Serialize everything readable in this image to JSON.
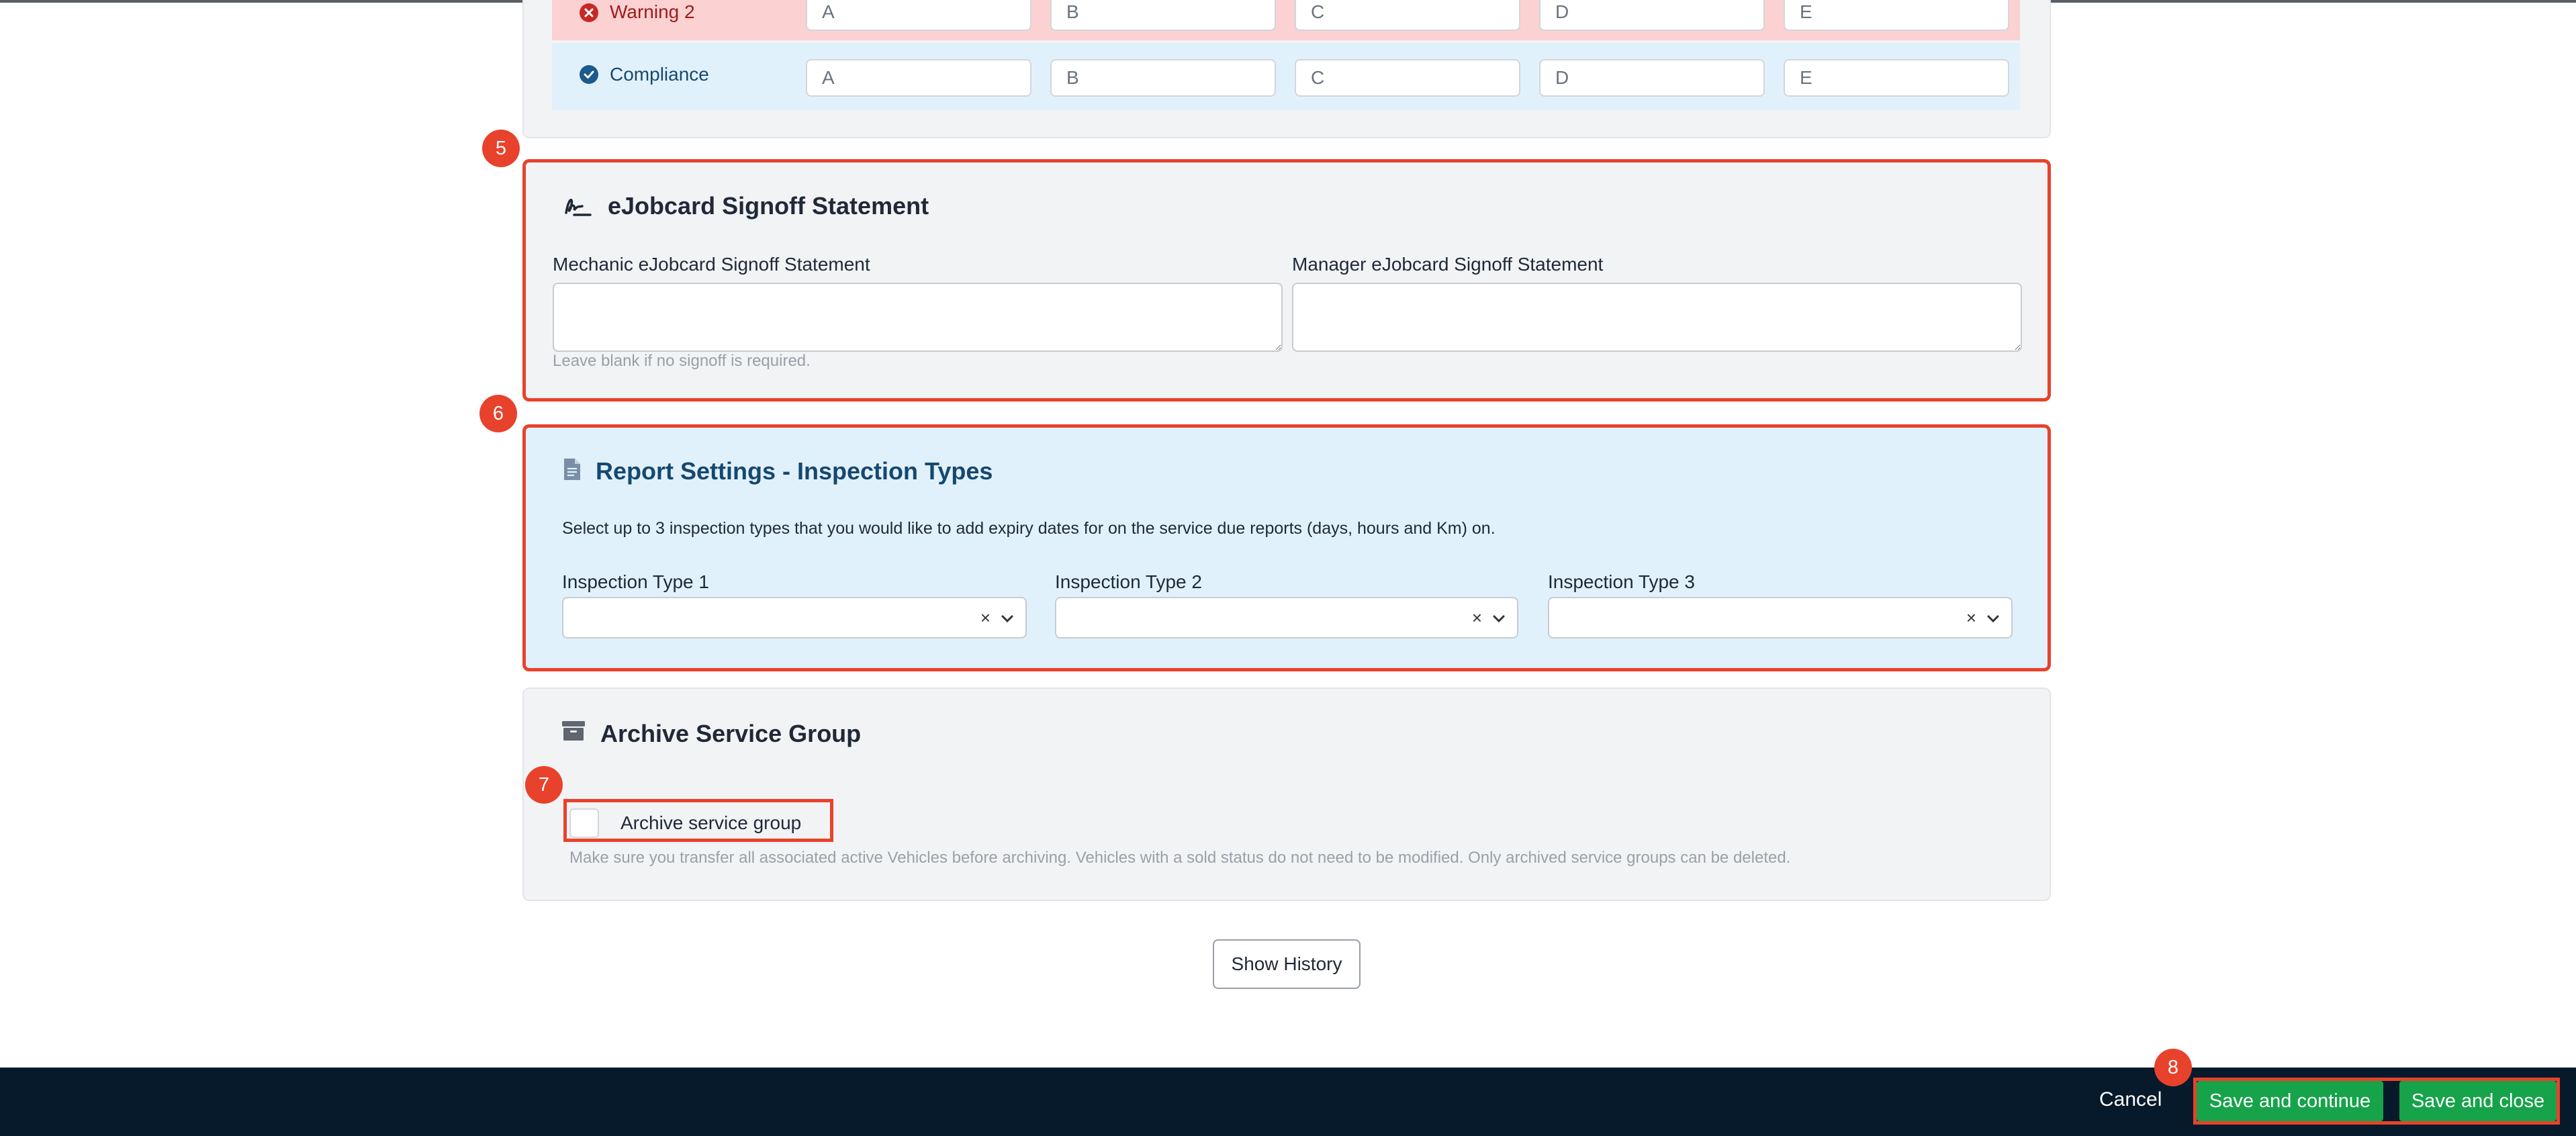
{
  "options_table": {
    "rows": [
      {
        "label": "Warning 2",
        "status": "error",
        "cells": [
          "A",
          "B",
          "C",
          "D",
          "E"
        ]
      },
      {
        "label": "Compliance",
        "status": "ok",
        "cells": [
          "A",
          "B",
          "C",
          "D",
          "E"
        ]
      }
    ]
  },
  "signoff": {
    "badge": "5",
    "title": "eJobcard Signoff Statement",
    "mechanic_label": "Mechanic eJobcard Signoff Statement",
    "manager_label": "Manager eJobcard Signoff Statement",
    "help": "Leave blank if no signoff is required."
  },
  "report_settings": {
    "badge": "6",
    "title": "Report Settings - Inspection Types",
    "description": "Select up to 3 inspection types that you would like to add expiry dates for on the service due reports (days, hours and Km) on.",
    "fields": [
      {
        "label": "Inspection Type 1",
        "value": ""
      },
      {
        "label": "Inspection Type 2",
        "value": ""
      },
      {
        "label": "Inspection Type 3",
        "value": ""
      }
    ],
    "clear_glyph": "×"
  },
  "archive": {
    "badge": "7",
    "title": "Archive Service Group",
    "checkbox_label": "Archive service group",
    "checked": false,
    "help": "Make sure you transfer all associated active Vehicles before archiving. Vehicles with a sold status do not need to be modified. Only archived service groups can be deleted."
  },
  "history_button": "Show History",
  "footer": {
    "badge": "8",
    "cancel": "Cancel",
    "save_continue": "Save and continue",
    "save_close": "Save and close"
  },
  "colors": {
    "highlight": "#e8422c",
    "success": "#16a34a",
    "footer_bg": "#071a2b",
    "warning_row": "#fbd1d1",
    "compliance_row": "#e1f1fc",
    "error_icon": "#c62828",
    "ok_icon": "#1a5a8c"
  }
}
